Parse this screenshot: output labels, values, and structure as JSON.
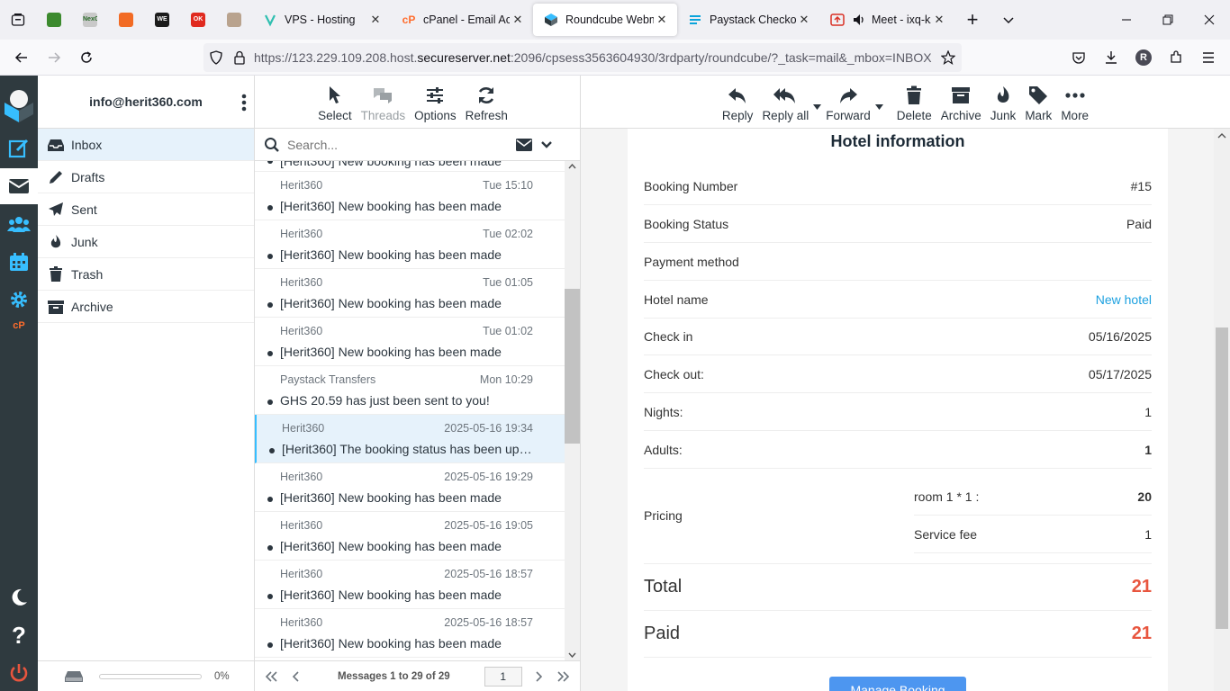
{
  "browser": {
    "tabs": [
      {
        "title": "VPS - Hosting"
      },
      {
        "title": "cPanel - Email Accounts"
      },
      {
        "title": "Roundcube Webmail"
      },
      {
        "title": "Paystack Checkout"
      },
      {
        "title": "Meet - ixq-kzrb"
      }
    ],
    "pinned": [
      {
        "label": "",
        "color": "#3c8a2e"
      },
      {
        "label": "NexGen",
        "color": "#c9c9c9"
      },
      {
        "label": "",
        "color": "#f26b24"
      },
      {
        "label": "WE",
        "color": "#1b1b1b"
      },
      {
        "label": "OK",
        "color": "#e02a1f"
      },
      {
        "label": "",
        "color": "#b9a38e"
      }
    ],
    "url_pre": "https://123.229.109.208.host.",
    "url_domain": "secureserver.net",
    "url_post": ":2096/cpsess3563604930/3rdparty/roundcube/?_task=mail&_mbox=INBOX",
    "profile_initial": "R"
  },
  "account": "info@herit360.com",
  "folders": [
    {
      "label": "Inbox",
      "icon": "inbox-icon"
    },
    {
      "label": "Drafts",
      "icon": "pencil-icon"
    },
    {
      "label": "Sent",
      "icon": "paper-plane-icon"
    },
    {
      "label": "Junk",
      "icon": "fire-icon"
    },
    {
      "label": "Trash",
      "icon": "trash-icon"
    },
    {
      "label": "Archive",
      "icon": "archive-icon"
    }
  ],
  "quota": {
    "percent_label": "0%",
    "fill": 0
  },
  "list_toolbar": {
    "select": "Select",
    "threads": "Threads",
    "options": "Options",
    "refresh": "Refresh"
  },
  "search": {
    "placeholder": "Search..."
  },
  "messages": {
    "partial_subject": "[Herit360] New booking has been made",
    "items": [
      {
        "from": "Herit360",
        "date": "Tue 15:10",
        "subject": "[Herit360] New booking has been made"
      },
      {
        "from": "Herit360",
        "date": "Tue 02:02",
        "subject": "[Herit360] New booking has been made"
      },
      {
        "from": "Herit360",
        "date": "Tue 01:05",
        "subject": "[Herit360] New booking has been made"
      },
      {
        "from": "Herit360",
        "date": "Tue 01:02",
        "subject": "[Herit360] New booking has been made"
      },
      {
        "from": "Paystack Transfers",
        "date": "Mon 10:29",
        "subject": "GHS 20.59 has just been sent to you!"
      },
      {
        "from": "Herit360",
        "date": "2025-05-16 19:34",
        "subject": "[Herit360] The booking status has been updated"
      },
      {
        "from": "Herit360",
        "date": "2025-05-16 19:29",
        "subject": "[Herit360] New booking has been made"
      },
      {
        "from": "Herit360",
        "date": "2025-05-16 19:05",
        "subject": "[Herit360] New booking has been made"
      },
      {
        "from": "Herit360",
        "date": "2025-05-16 18:57",
        "subject": "[Herit360] New booking has been made"
      },
      {
        "from": "Herit360",
        "date": "2025-05-16 18:57",
        "subject": "[Herit360] New booking has been made"
      }
    ],
    "count_label": "Messages 1 to 29 of 29",
    "page": "1"
  },
  "mail_toolbar": {
    "reply": "Reply",
    "reply_all": "Reply all",
    "forward": "Forward",
    "delete": "Delete",
    "archive": "Archive",
    "junk": "Junk",
    "mark": "Mark",
    "more": "More"
  },
  "mail": {
    "heading": "Hotel information",
    "booking_number_label": "Booking Number",
    "booking_number": "#15",
    "booking_status_label": "Booking Status",
    "booking_status": "Paid",
    "payment_method_label": "Payment method",
    "payment_method": "",
    "hotel_name_label": "Hotel name",
    "hotel_name": "New hotel",
    "check_in_label": "Check in",
    "check_in": "05/16/2025",
    "check_out_label": "Check out:",
    "check_out": "05/17/2025",
    "nights_label": "Nights:",
    "nights": "1",
    "adults_label": "Adults:",
    "adults": "1",
    "pricing_label": "Pricing",
    "room_label": "room 1 * 1 :",
    "room_value": "20",
    "fee_label": "Service fee",
    "fee_value": "1",
    "total_label": "Total",
    "total": "21",
    "paid_label": "Paid",
    "paid": "21",
    "button_label": "Manage Booking"
  }
}
